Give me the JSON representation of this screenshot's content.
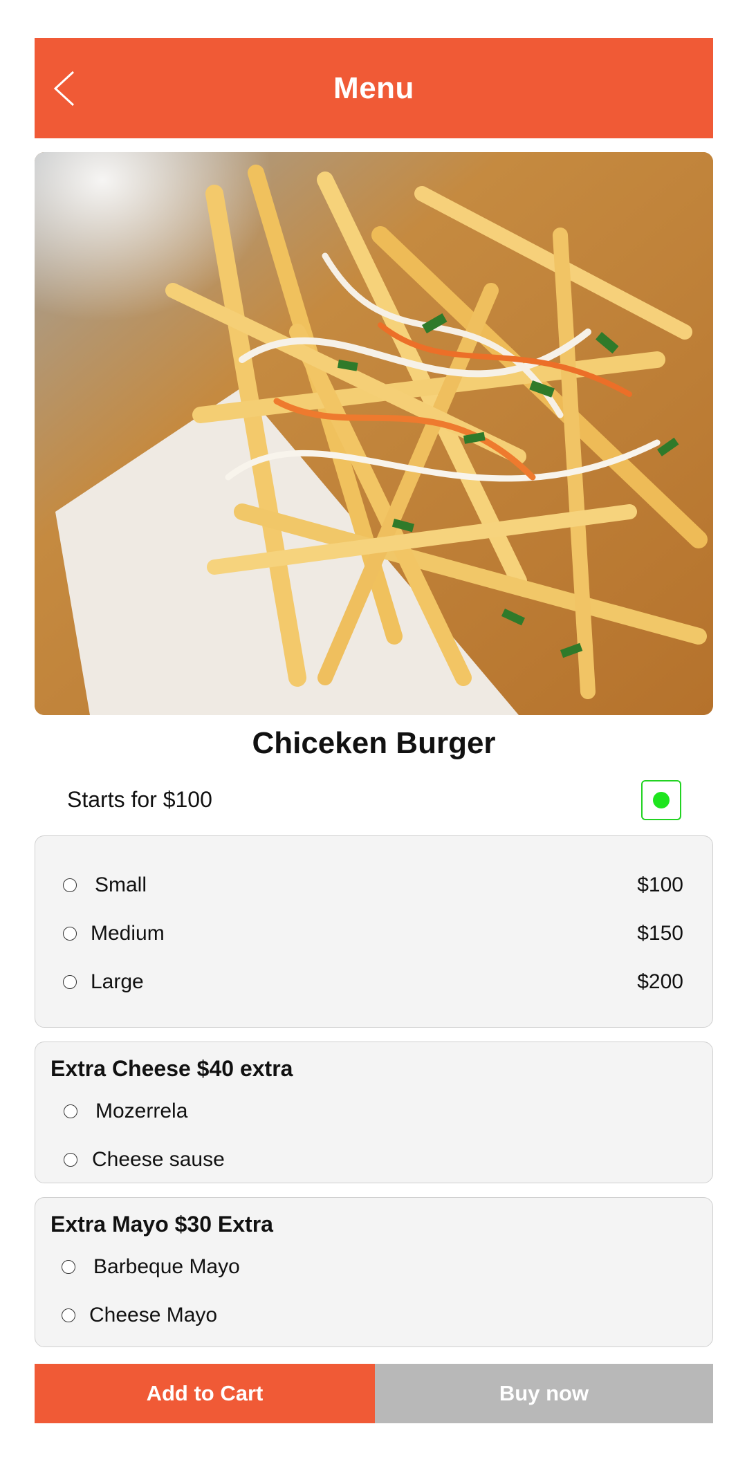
{
  "header": {
    "title": "Menu"
  },
  "product": {
    "name": "Chiceken Burger",
    "starts_for": "Starts for $100",
    "veg_color": "#1ee51e"
  },
  "sizes": [
    {
      "label": "Small",
      "price": "$100"
    },
    {
      "label": "Medium",
      "price": "$150"
    },
    {
      "label": "Large",
      "price": "$200"
    }
  ],
  "cheese": {
    "title": "Extra  Cheese $40 extra",
    "options": [
      "Mozerrela",
      "Cheese sause"
    ]
  },
  "mayo": {
    "title": "Extra Mayo $30 Extra",
    "options": [
      "Barbeque Mayo",
      "Cheese Mayo"
    ]
  },
  "actions": {
    "add_to_cart": "Add to Cart",
    "buy_now": "Buy now"
  },
  "colors": {
    "accent": "#f05a36",
    "secondary_button": "#b8b8b8"
  }
}
